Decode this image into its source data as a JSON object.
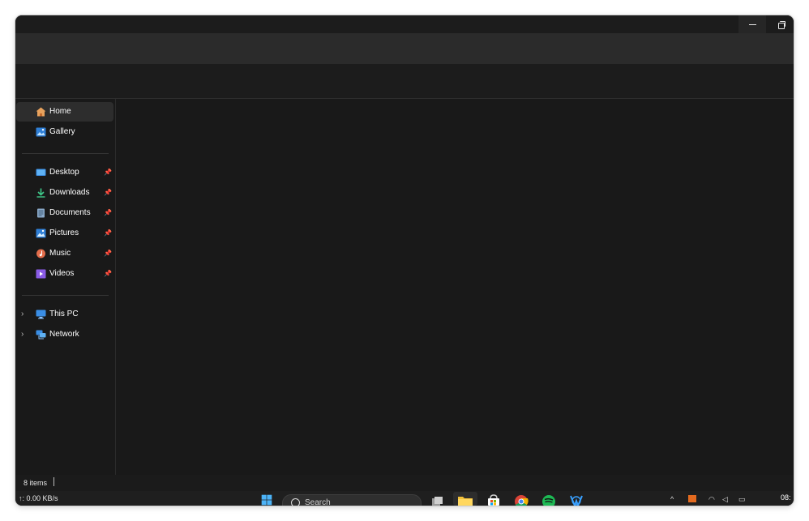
{
  "window": {
    "controls": {
      "minimize": "minimize-icon",
      "restore": "restore-icon"
    }
  },
  "sidebar": {
    "items": [
      {
        "label": "Home",
        "icon": "home-icon",
        "selected": true
      },
      {
        "label": "Gallery",
        "icon": "gallery-icon"
      },
      {
        "label": "Desktop",
        "icon": "desktop-icon",
        "pinned": true
      },
      {
        "label": "Downloads",
        "icon": "downloads-icon",
        "pinned": true
      },
      {
        "label": "Documents",
        "icon": "documents-icon",
        "pinned": true
      },
      {
        "label": "Pictures",
        "icon": "pictures-icon",
        "pinned": true
      },
      {
        "label": "Music",
        "icon": "music-icon",
        "pinned": true
      },
      {
        "label": "Videos",
        "icon": "videos-icon",
        "pinned": true
      },
      {
        "label": "This PC",
        "icon": "this-pc-icon",
        "expandable": true
      },
      {
        "label": "Network",
        "icon": "network-icon",
        "expandable": true
      }
    ]
  },
  "status": {
    "items": "8 items"
  },
  "taskbar": {
    "net_speed": "↑: 0.00 KB/s",
    "search_label": "Search",
    "clock": "08:"
  },
  "colors": {
    "window_bg": "#191919",
    "toolbar_bg": "#2b2b2b",
    "selected_bg": "#2d2d2d",
    "accent_blue": "#3a8ee6",
    "folder_yellow": "#f3c13a",
    "spotify_green": "#1db954"
  }
}
